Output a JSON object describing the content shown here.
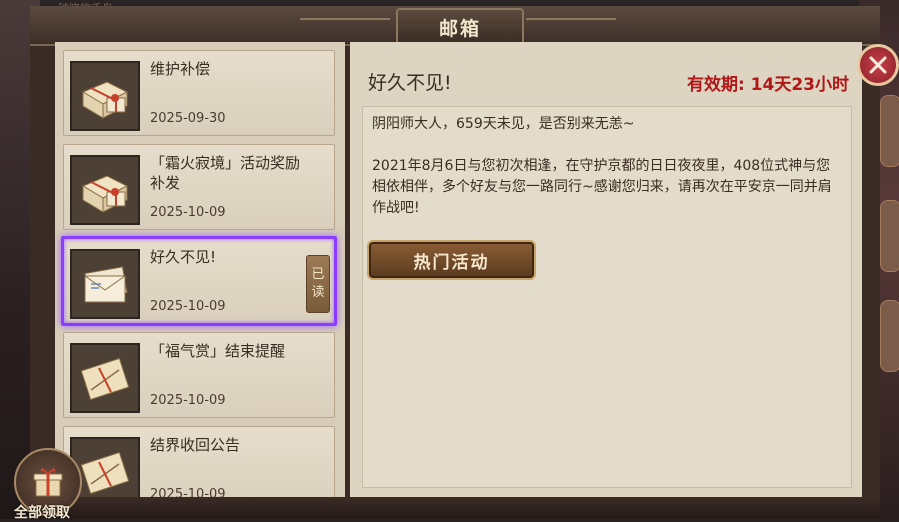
{
  "window": {
    "title": "邮箱"
  },
  "background": {
    "top_text": "破晓的千鸟"
  },
  "mail_list": [
    {
      "title": "维护补偿",
      "date": "2025-09-30",
      "icon": "gift-package-icon",
      "read": false,
      "selected": false
    },
    {
      "title": "「霜火寂境」活动奖励补发",
      "date": "2025-10-09",
      "icon": "gift-package-icon",
      "read": false,
      "selected": false
    },
    {
      "title": "好久不见!",
      "date": "2025-10-09",
      "icon": "letter-envelope-icon",
      "read": true,
      "read_label_1": "已",
      "read_label_2": "读",
      "selected": true
    },
    {
      "title": "「福气赏」结束提醒",
      "date": "2025-10-09",
      "icon": "scroll-letter-icon",
      "read": false,
      "selected": false
    },
    {
      "title": "结界收回公告",
      "date": "2025-10-09",
      "icon": "scroll-letter-icon",
      "read": false,
      "selected": false
    }
  ],
  "detail": {
    "title": "好久不见!",
    "expiry": "有效期: 14天23小时",
    "body": "阴阳师大人，659天未见，是否别来无恙~\n\n2021年8月6日与您初次相逢，在守护京都的日日夜夜里，408位式神与您相依相伴，多个好友与您一路同行~感谢您归来，请再次在平安京一同并肩作战吧!",
    "button_label": "热门活动"
  },
  "claim_all": {
    "label": "全部领取"
  },
  "colors": {
    "accent_red": "#b01818",
    "selection": "#8a3cff",
    "panel": "#ddd4c2"
  }
}
